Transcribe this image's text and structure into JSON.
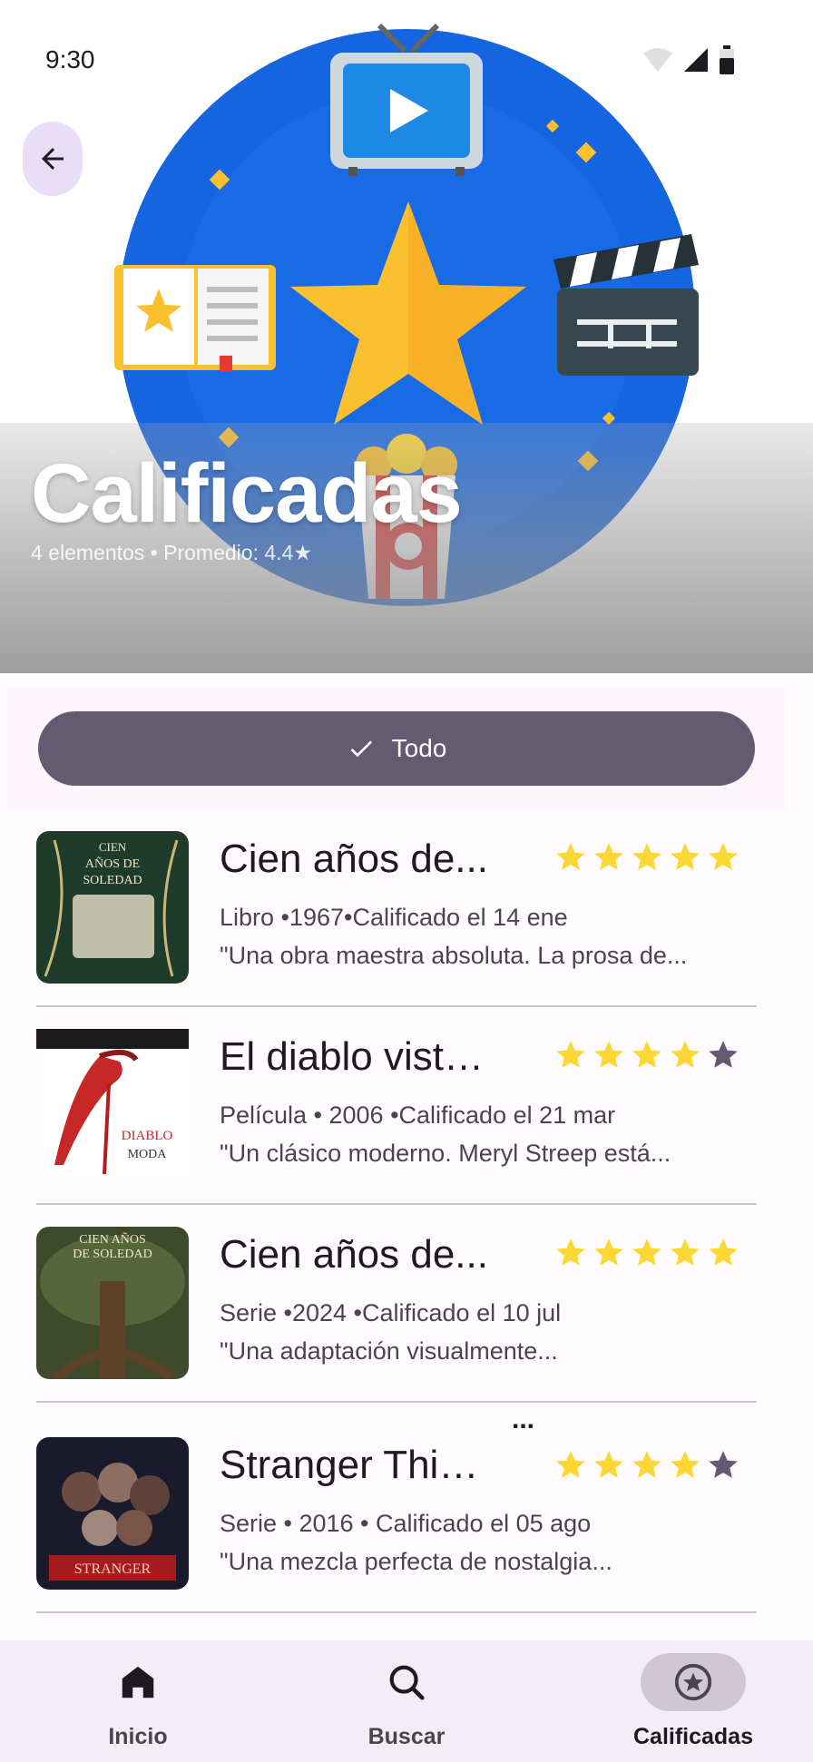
{
  "status_bar": {
    "time": "9:30"
  },
  "header": {
    "title": "Calificadas",
    "subtitle": "4 elementos • Promedio: 4.4★"
  },
  "filter": {
    "chip_label": "Todo",
    "chip_icon": "check-icon"
  },
  "items": [
    {
      "title": "Cien años de...",
      "meta": "Libro •1967•Calificado el 14 ene",
      "review": "\"Una obra maestra absoluta. La prosa de...",
      "rating": 5,
      "max_rating": 5,
      "thumb_color": "#1f3b2c"
    },
    {
      "title": "El diablo viste a...",
      "meta": "Película • 2006 •Calificado el 21 mar",
      "review": "\"Un clásico moderno. Meryl Streep está...",
      "rating": 4,
      "max_rating": 5,
      "thumb_color": "#ffffff"
    },
    {
      "title": "Cien años de...",
      "meta": "Serie •2024 •Calificado el 10 jul",
      "review": "\"Una adaptación visualmente...",
      "rating": 5,
      "max_rating": 5,
      "thumb_color": "#4a4a2a"
    },
    {
      "title": "Stranger Things",
      "meta": "Serie • 2016 • Calificado el 05 ago",
      "review": "\"Una mezcla perfecta de nostalgia...",
      "rating": 4,
      "max_rating": 5,
      "thumb_color": "#1a1a2e",
      "overflow": "..."
    }
  ],
  "bottom_nav": [
    {
      "label": "Inicio",
      "icon": "home-icon",
      "active": false
    },
    {
      "label": "Buscar",
      "icon": "search-icon",
      "active": false
    },
    {
      "label": "Calificadas",
      "icon": "star-circle-icon",
      "active": true
    }
  ],
  "colors": {
    "star_filled": "#fdd835",
    "star_empty": "#625b71",
    "chip_bg": "#625b71",
    "hero_circle": "#1565e0"
  }
}
